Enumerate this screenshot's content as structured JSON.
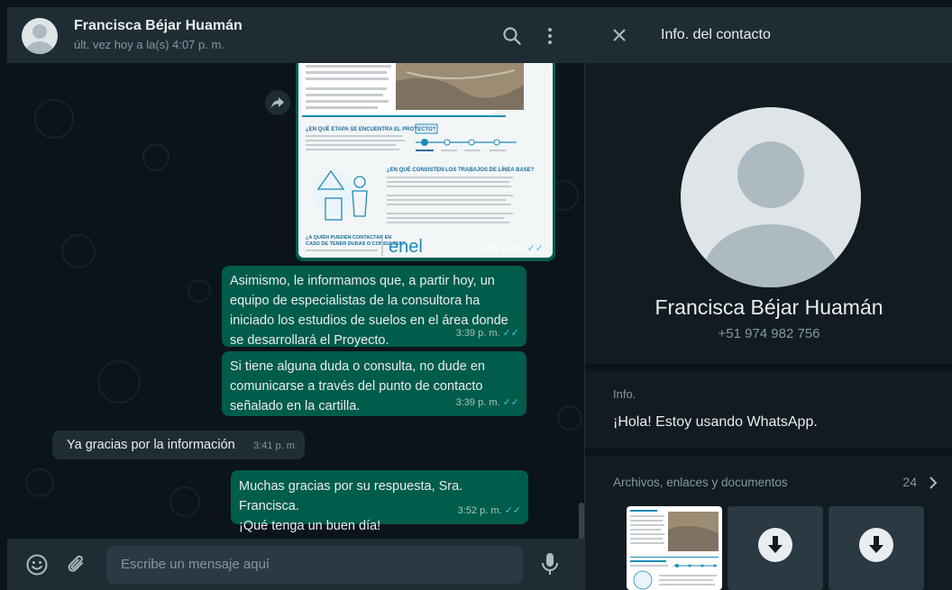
{
  "chat_header": {
    "contact_name": "Francisca Béjar Huamán",
    "status": "últ. vez hoy a la(s) 4:07 p. m."
  },
  "image_message": {
    "brand": "enel",
    "time": "3:39 p. m."
  },
  "messages": [
    {
      "direction": "out",
      "text": "Asimismo, le informamos que, a partir hoy, un\nequipo de especialistas de la consultora ha\niniciado los estudios de suelos en el área donde\nse desarrollará el Proyecto.",
      "time": "3:39 p. m."
    },
    {
      "direction": "out",
      "text": "Si tiene alguna duda o consulta, no dude en\ncomunicarse a través del punto de contacto\nseñalado en la cartilla.",
      "time": "3:39 p. m."
    },
    {
      "direction": "in",
      "text": "Ya gracias por la información",
      "time": "3:41 p. m."
    },
    {
      "direction": "out",
      "text": "Muchas gracias por su respuesta, Sra. Francisca.\n¡Qué tenga un buen día!",
      "time": "3:52 p. m."
    }
  ],
  "composer": {
    "placeholder": "Escribe un mensaje aquí"
  },
  "contact_panel": {
    "title": "Info. del contacto",
    "name": "Francisca Béjar Huamán",
    "phone": "+51 974 982 756",
    "info_label": "Info.",
    "info_text": "¡Hola! Estoy usando WhatsApp.",
    "files_label": "Archivos, enlaces y documentos",
    "files_count": "24"
  },
  "colors": {
    "outgoing_bubble": "#005c4b",
    "incoming_bubble": "#202c33",
    "read_ticks": "#53bdeb",
    "header": "#202c33"
  },
  "icons": [
    "search-icon",
    "menu-icon",
    "forward-icon",
    "emoji-icon",
    "attach-icon",
    "mic-icon",
    "close-icon",
    "chevron-right-icon",
    "download-icon"
  ]
}
